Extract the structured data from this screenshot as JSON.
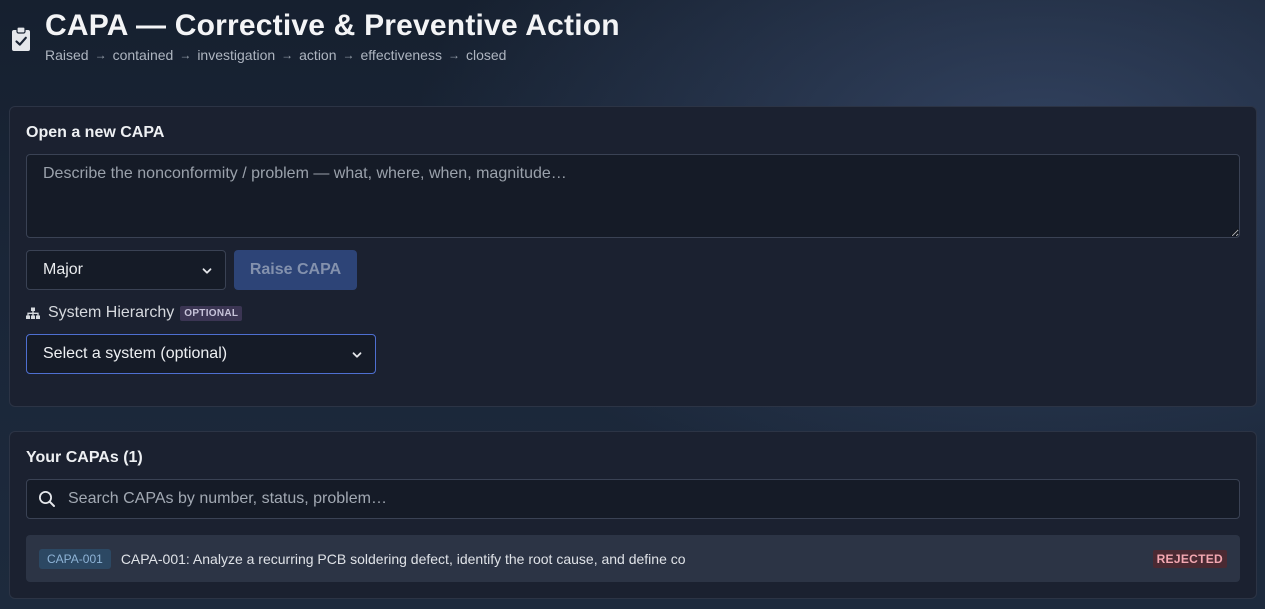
{
  "header": {
    "title": "CAPA — Corrective & Preventive Action",
    "steps": [
      "Raised",
      "contained",
      "investigation",
      "action",
      "effectiveness",
      "closed"
    ],
    "arrow": "→",
    "icon": "clipboard-check-icon"
  },
  "new_capa": {
    "heading": "Open a new CAPA",
    "problem_placeholder": "Describe the nonconformity / problem — what, where, when, magnitude…",
    "severity_value": "Major",
    "raise_label": "Raise CAPA",
    "hierarchy_label": "System Hierarchy",
    "hierarchy_badge": "OPTIONAL",
    "system_placeholder": "Select a system (optional)"
  },
  "capa_list": {
    "heading": "Your CAPAs (1)",
    "search_placeholder": "Search CAPAs by number, status, problem…",
    "items": [
      {
        "id": "CAPA-001",
        "title": "CAPA-001: Analyze a recurring PCB soldering defect, identify the root cause, and define co",
        "status": "REJECTED"
      }
    ]
  },
  "colors": {
    "accent": "#4e6fd1",
    "button_disabled_bg": "#2d4477",
    "status_rejected": "#f3a8b2"
  }
}
